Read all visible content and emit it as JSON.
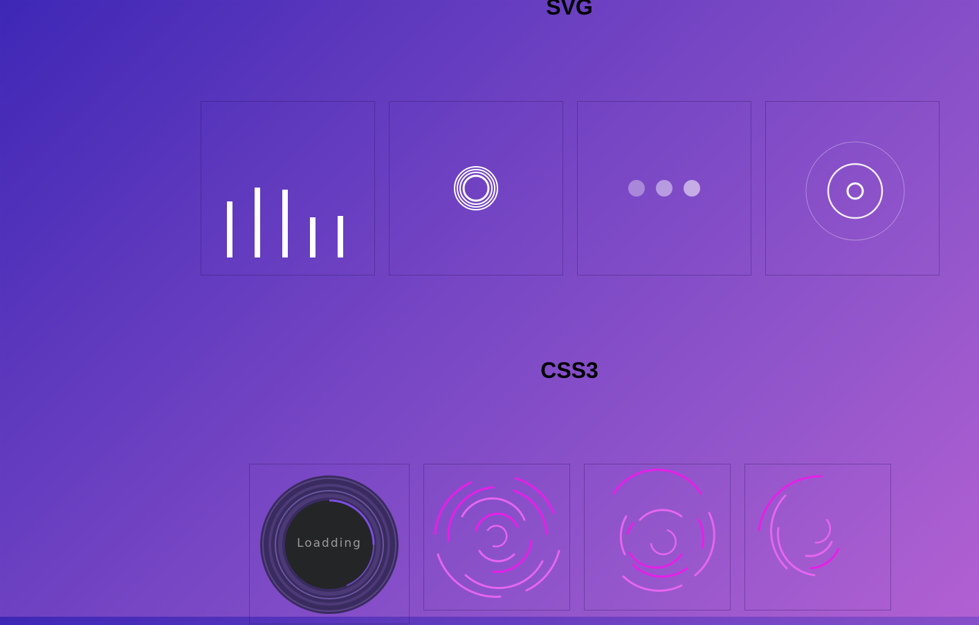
{
  "sections": {
    "svg": {
      "title": "SVG"
    },
    "css3": {
      "title": "CSS3",
      "spinner_text": "Loadding"
    }
  },
  "colors": {
    "bg_start": "#3e27b6",
    "bg_end": "#b260d2",
    "magenta": "#e81ee8",
    "white": "#ffffff",
    "dark_disc": "#242527"
  },
  "icons": {
    "svg_1": "equalizer-bars-icon",
    "svg_2": "concentric-rings-icon",
    "svg_3": "three-dots-icon",
    "svg_4": "target-pulse-icon",
    "css_1": "loading-disc-icon",
    "css_2": "arc-rings-spinner-icon",
    "css_3": "arc-rings-spinner-icon",
    "css_4": "arc-swirl-spinner-icon"
  }
}
